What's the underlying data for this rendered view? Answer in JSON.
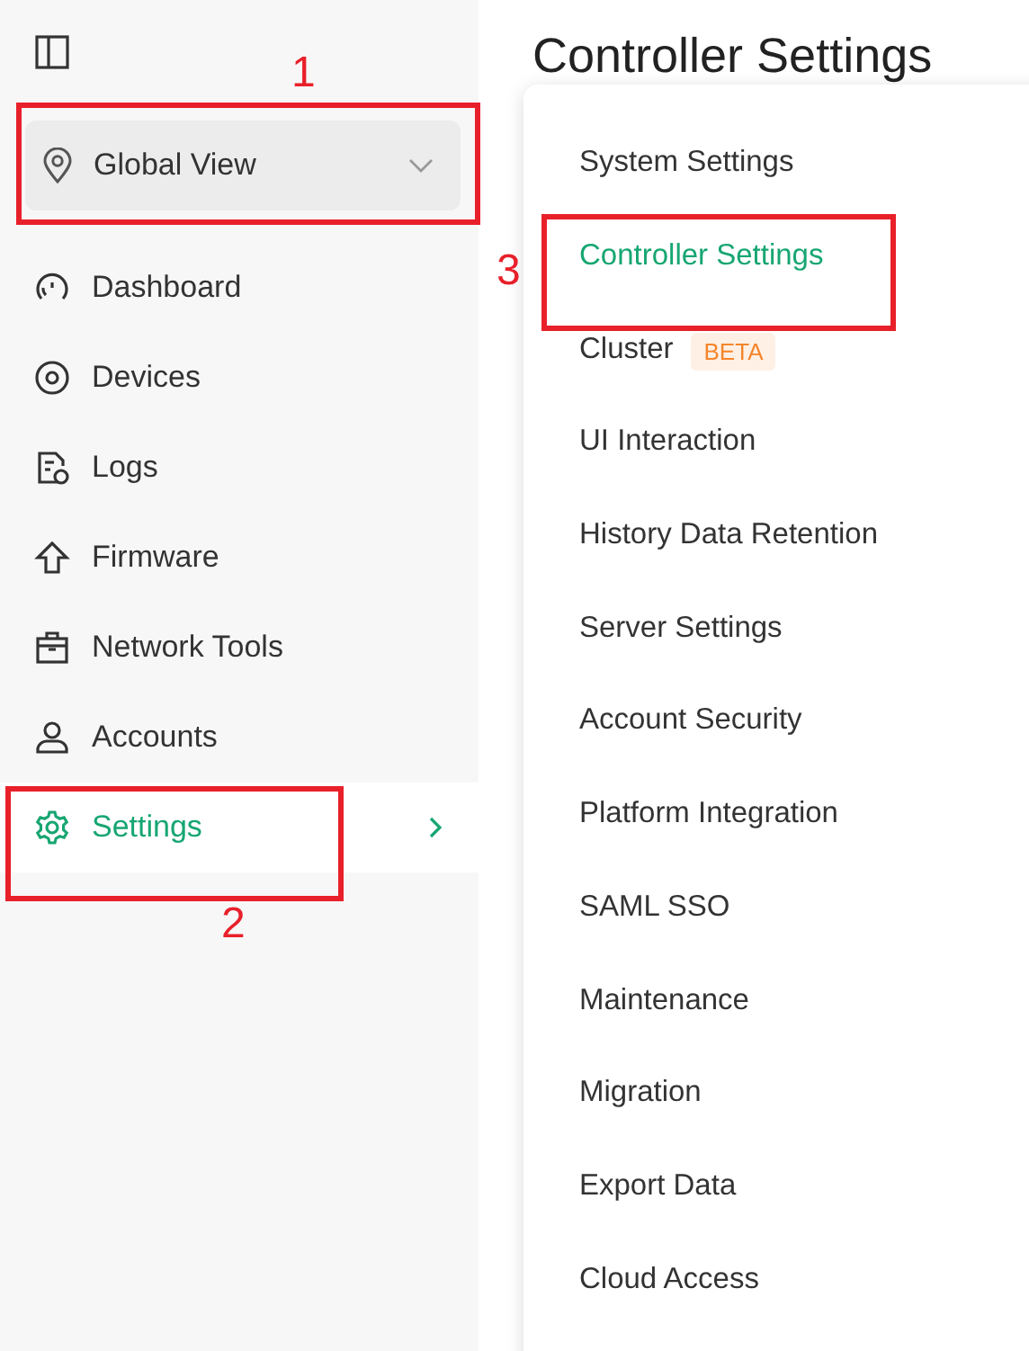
{
  "sidebar": {
    "global_view": {
      "label": "Global View"
    },
    "items": [
      {
        "label": "Dashboard",
        "selected": false
      },
      {
        "label": "Devices",
        "selected": false
      },
      {
        "label": "Logs",
        "selected": false
      },
      {
        "label": "Firmware",
        "selected": false
      },
      {
        "label": "Network Tools",
        "selected": false
      },
      {
        "label": "Accounts",
        "selected": false
      },
      {
        "label": "Settings",
        "selected": true
      }
    ]
  },
  "page": {
    "title": "Controller Settings"
  },
  "submenu": {
    "items": [
      {
        "label": "System Settings",
        "selected": false
      },
      {
        "label": "Controller Settings",
        "selected": true
      },
      {
        "label": "Cluster",
        "badge": "BETA",
        "selected": false
      },
      {
        "label": "UI Interaction",
        "selected": false
      },
      {
        "label": "History Data Retention",
        "selected": false
      },
      {
        "label": "Server Settings",
        "selected": false
      },
      {
        "label": "Account Security",
        "selected": false
      },
      {
        "label": "Platform Integration",
        "selected": false
      },
      {
        "label": "SAML SSO",
        "selected": false
      },
      {
        "label": "Maintenance",
        "selected": false
      },
      {
        "label": "Migration",
        "selected": false
      },
      {
        "label": "Export Data",
        "selected": false
      },
      {
        "label": "Cloud Access",
        "selected": false
      }
    ]
  },
  "annotations": [
    {
      "number": "1"
    },
    {
      "number": "2"
    },
    {
      "number": "3"
    }
  ]
}
